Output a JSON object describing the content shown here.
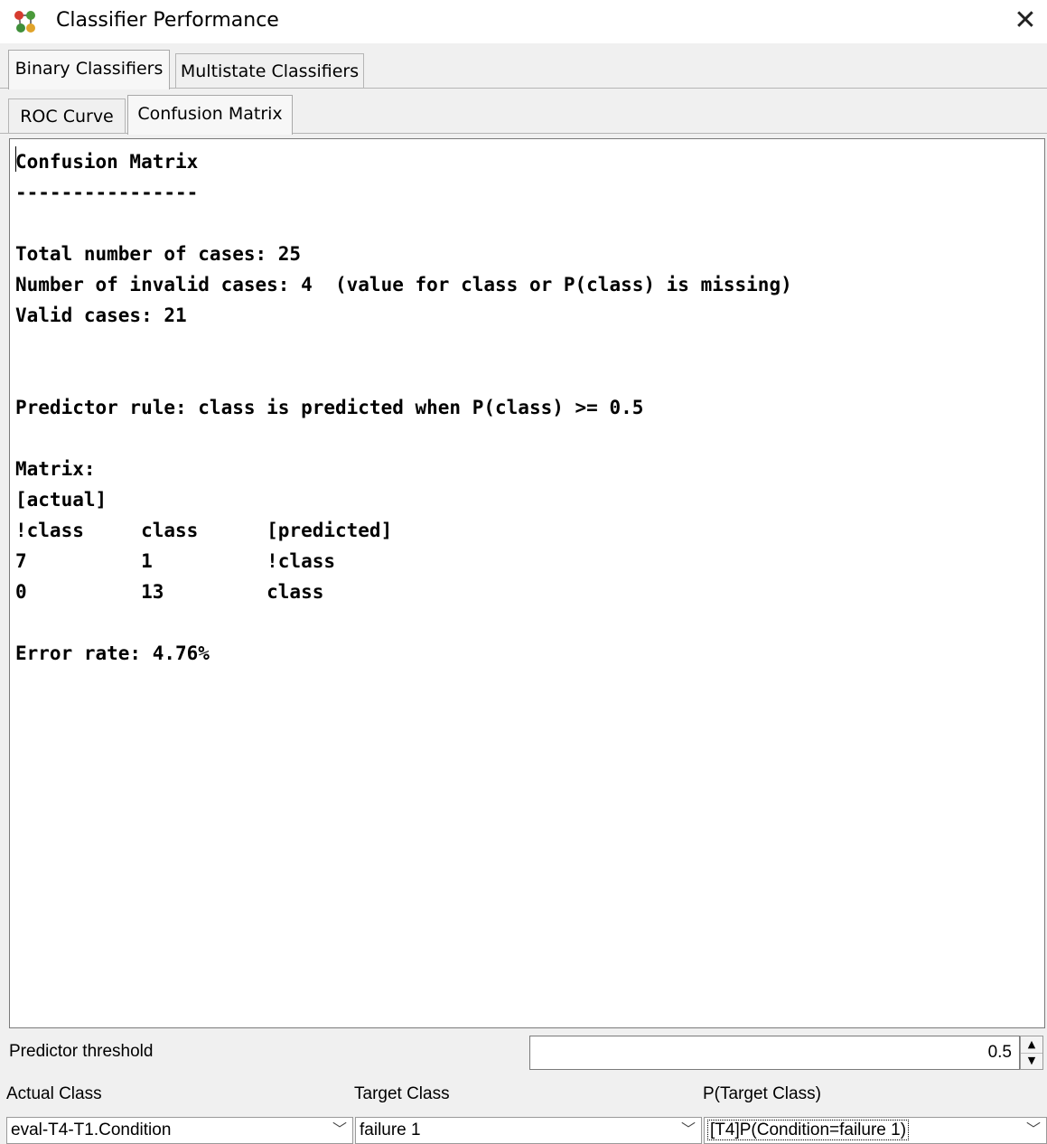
{
  "window": {
    "title": "Classifier Performance",
    "close_icon": "close-icon",
    "app_icon": "network-nodes-icon"
  },
  "tabs_outer": [
    {
      "label": "Binary Classifiers",
      "active": true
    },
    {
      "label": "Multistate Classifiers",
      "active": false
    }
  ],
  "tabs_inner": [
    {
      "label": "ROC Curve",
      "active": false
    },
    {
      "label": "Confusion Matrix",
      "active": true
    }
  ],
  "report": {
    "heading": "Confusion Matrix",
    "underline": "----------------",
    "total_cases": "Total number of cases: 25",
    "invalid_cases": "Number of invalid cases: 4  (value for class or P(class) is missing)",
    "valid_cases": "Valid cases: 21",
    "predictor_rule": "Predictor rule: class is predicted when P(class) >= 0.5",
    "matrix_label": "Matrix:",
    "actual_label": "[actual]",
    "matrix_header": "!class     class      [predicted]",
    "matrix_row1": "7          1          !class",
    "matrix_row2": "0          13         class",
    "error_rate": "Error rate: 4.76%"
  },
  "threshold": {
    "label": "Predictor threshold",
    "value": "0.5"
  },
  "selectors": {
    "actual_class": {
      "label": "Actual Class",
      "value": "eval-T4-T1.Condition"
    },
    "target_class": {
      "label": "Target Class",
      "value": "failure 1"
    },
    "p_target_class": {
      "label": "P(Target Class)",
      "value": "[T4]P(Condition=failure 1)"
    }
  }
}
